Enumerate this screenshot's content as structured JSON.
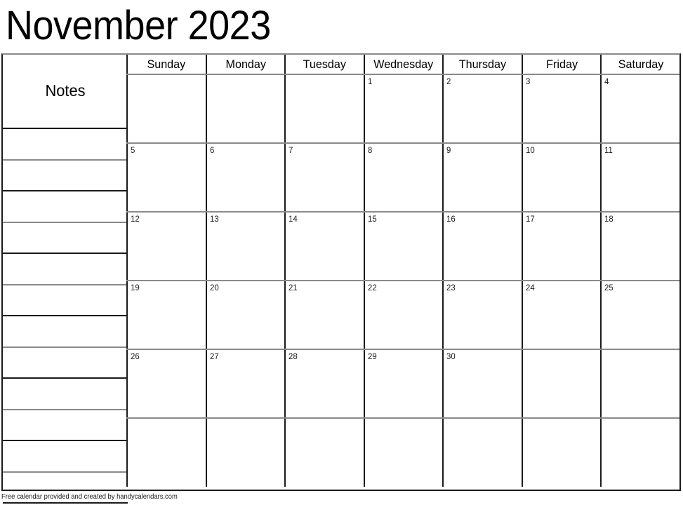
{
  "title": "November 2023",
  "notes": {
    "label": "Notes",
    "line_count": 13
  },
  "weekdays": [
    "Sunday",
    "Monday",
    "Tuesday",
    "Wednesday",
    "Thursday",
    "Friday",
    "Saturday"
  ],
  "weeks": [
    [
      "",
      "",
      "",
      "1",
      "2",
      "3",
      "4"
    ],
    [
      "5",
      "6",
      "7",
      "8",
      "9",
      "10",
      "11"
    ],
    [
      "12",
      "13",
      "14",
      "15",
      "16",
      "17",
      "18"
    ],
    [
      "19",
      "20",
      "21",
      "22",
      "23",
      "24",
      "25"
    ],
    [
      "26",
      "27",
      "28",
      "29",
      "30",
      "",
      ""
    ],
    [
      "",
      "",
      "",
      "",
      "",
      "",
      ""
    ]
  ],
  "footer": "Free calendar provided and created by handycalendars.com",
  "colors": {
    "border_dark": "#1a1a1a",
    "border_light": "#8a8a8a",
    "background": "#ffffff",
    "text": "#000000"
  }
}
